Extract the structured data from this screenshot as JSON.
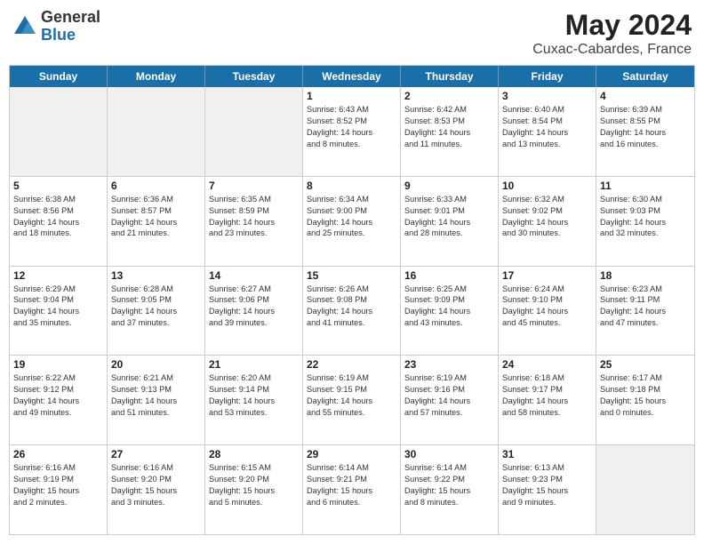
{
  "logo": {
    "general": "General",
    "blue": "Blue"
  },
  "title": "May 2024",
  "subtitle": "Cuxac-Cabardes, France",
  "days": [
    "Sunday",
    "Monday",
    "Tuesday",
    "Wednesday",
    "Thursday",
    "Friday",
    "Saturday"
  ],
  "weeks": [
    [
      {
        "day": "",
        "lines": [],
        "shaded": true
      },
      {
        "day": "",
        "lines": [],
        "shaded": true
      },
      {
        "day": "",
        "lines": [],
        "shaded": true
      },
      {
        "day": "1",
        "lines": [
          "Sunrise: 6:43 AM",
          "Sunset: 8:52 PM",
          "Daylight: 14 hours",
          "and 8 minutes."
        ]
      },
      {
        "day": "2",
        "lines": [
          "Sunrise: 6:42 AM",
          "Sunset: 8:53 PM",
          "Daylight: 14 hours",
          "and 11 minutes."
        ]
      },
      {
        "day": "3",
        "lines": [
          "Sunrise: 6:40 AM",
          "Sunset: 8:54 PM",
          "Daylight: 14 hours",
          "and 13 minutes."
        ]
      },
      {
        "day": "4",
        "lines": [
          "Sunrise: 6:39 AM",
          "Sunset: 8:55 PM",
          "Daylight: 14 hours",
          "and 16 minutes."
        ]
      }
    ],
    [
      {
        "day": "5",
        "lines": [
          "Sunrise: 6:38 AM",
          "Sunset: 8:56 PM",
          "Daylight: 14 hours",
          "and 18 minutes."
        ]
      },
      {
        "day": "6",
        "lines": [
          "Sunrise: 6:36 AM",
          "Sunset: 8:57 PM",
          "Daylight: 14 hours",
          "and 21 minutes."
        ]
      },
      {
        "day": "7",
        "lines": [
          "Sunrise: 6:35 AM",
          "Sunset: 8:59 PM",
          "Daylight: 14 hours",
          "and 23 minutes."
        ]
      },
      {
        "day": "8",
        "lines": [
          "Sunrise: 6:34 AM",
          "Sunset: 9:00 PM",
          "Daylight: 14 hours",
          "and 25 minutes."
        ]
      },
      {
        "day": "9",
        "lines": [
          "Sunrise: 6:33 AM",
          "Sunset: 9:01 PM",
          "Daylight: 14 hours",
          "and 28 minutes."
        ]
      },
      {
        "day": "10",
        "lines": [
          "Sunrise: 6:32 AM",
          "Sunset: 9:02 PM",
          "Daylight: 14 hours",
          "and 30 minutes."
        ]
      },
      {
        "day": "11",
        "lines": [
          "Sunrise: 6:30 AM",
          "Sunset: 9:03 PM",
          "Daylight: 14 hours",
          "and 32 minutes."
        ]
      }
    ],
    [
      {
        "day": "12",
        "lines": [
          "Sunrise: 6:29 AM",
          "Sunset: 9:04 PM",
          "Daylight: 14 hours",
          "and 35 minutes."
        ]
      },
      {
        "day": "13",
        "lines": [
          "Sunrise: 6:28 AM",
          "Sunset: 9:05 PM",
          "Daylight: 14 hours",
          "and 37 minutes."
        ]
      },
      {
        "day": "14",
        "lines": [
          "Sunrise: 6:27 AM",
          "Sunset: 9:06 PM",
          "Daylight: 14 hours",
          "and 39 minutes."
        ]
      },
      {
        "day": "15",
        "lines": [
          "Sunrise: 6:26 AM",
          "Sunset: 9:08 PM",
          "Daylight: 14 hours",
          "and 41 minutes."
        ]
      },
      {
        "day": "16",
        "lines": [
          "Sunrise: 6:25 AM",
          "Sunset: 9:09 PM",
          "Daylight: 14 hours",
          "and 43 minutes."
        ]
      },
      {
        "day": "17",
        "lines": [
          "Sunrise: 6:24 AM",
          "Sunset: 9:10 PM",
          "Daylight: 14 hours",
          "and 45 minutes."
        ]
      },
      {
        "day": "18",
        "lines": [
          "Sunrise: 6:23 AM",
          "Sunset: 9:11 PM",
          "Daylight: 14 hours",
          "and 47 minutes."
        ]
      }
    ],
    [
      {
        "day": "19",
        "lines": [
          "Sunrise: 6:22 AM",
          "Sunset: 9:12 PM",
          "Daylight: 14 hours",
          "and 49 minutes."
        ]
      },
      {
        "day": "20",
        "lines": [
          "Sunrise: 6:21 AM",
          "Sunset: 9:13 PM",
          "Daylight: 14 hours",
          "and 51 minutes."
        ]
      },
      {
        "day": "21",
        "lines": [
          "Sunrise: 6:20 AM",
          "Sunset: 9:14 PM",
          "Daylight: 14 hours",
          "and 53 minutes."
        ]
      },
      {
        "day": "22",
        "lines": [
          "Sunrise: 6:19 AM",
          "Sunset: 9:15 PM",
          "Daylight: 14 hours",
          "and 55 minutes."
        ]
      },
      {
        "day": "23",
        "lines": [
          "Sunrise: 6:19 AM",
          "Sunset: 9:16 PM",
          "Daylight: 14 hours",
          "and 57 minutes."
        ]
      },
      {
        "day": "24",
        "lines": [
          "Sunrise: 6:18 AM",
          "Sunset: 9:17 PM",
          "Daylight: 14 hours",
          "and 58 minutes."
        ]
      },
      {
        "day": "25",
        "lines": [
          "Sunrise: 6:17 AM",
          "Sunset: 9:18 PM",
          "Daylight: 15 hours",
          "and 0 minutes."
        ]
      }
    ],
    [
      {
        "day": "26",
        "lines": [
          "Sunrise: 6:16 AM",
          "Sunset: 9:19 PM",
          "Daylight: 15 hours",
          "and 2 minutes."
        ]
      },
      {
        "day": "27",
        "lines": [
          "Sunrise: 6:16 AM",
          "Sunset: 9:20 PM",
          "Daylight: 15 hours",
          "and 3 minutes."
        ]
      },
      {
        "day": "28",
        "lines": [
          "Sunrise: 6:15 AM",
          "Sunset: 9:20 PM",
          "Daylight: 15 hours",
          "and 5 minutes."
        ]
      },
      {
        "day": "29",
        "lines": [
          "Sunrise: 6:14 AM",
          "Sunset: 9:21 PM",
          "Daylight: 15 hours",
          "and 6 minutes."
        ]
      },
      {
        "day": "30",
        "lines": [
          "Sunrise: 6:14 AM",
          "Sunset: 9:22 PM",
          "Daylight: 15 hours",
          "and 8 minutes."
        ]
      },
      {
        "day": "31",
        "lines": [
          "Sunrise: 6:13 AM",
          "Sunset: 9:23 PM",
          "Daylight: 15 hours",
          "and 9 minutes."
        ]
      },
      {
        "day": "",
        "lines": [],
        "shaded": true
      }
    ]
  ]
}
